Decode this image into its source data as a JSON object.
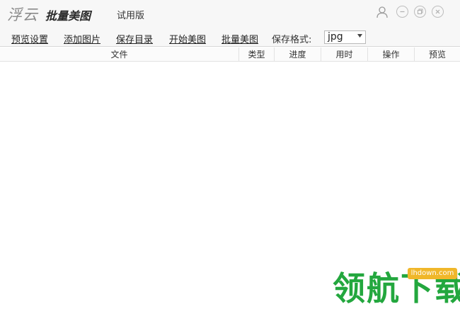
{
  "app": {
    "brand_script": "浮云",
    "brand_name": "批量美图",
    "edition": "试用版"
  },
  "window_controls": {
    "user": "user-icon",
    "minimize": "minimize-icon",
    "maximize": "maximize-icon",
    "close": "close-icon"
  },
  "toolbar": {
    "preview_settings": "预览设置",
    "add_images": "添加图片",
    "save_dir": "保存目录",
    "start": "开始美图",
    "batch": "批量美图",
    "format_label": "保存格式:",
    "format_value": "jpg"
  },
  "table": {
    "columns": [
      "文件",
      "类型",
      "进度",
      "用时",
      "操作",
      "预览"
    ]
  },
  "watermark": {
    "text": "领航下载",
    "url": "lhdown.com"
  },
  "colors": {
    "watermark_green": "#23a73e",
    "watermark_badge": "#f0b72a"
  }
}
